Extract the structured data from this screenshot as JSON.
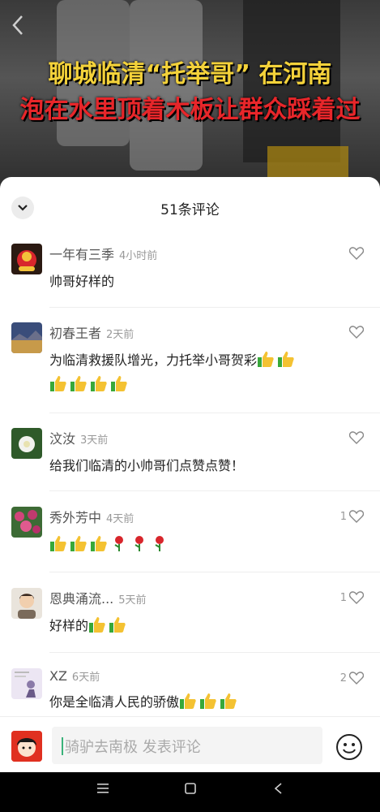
{
  "video": {
    "caption_line1": "聊城临清“托举哥” 在河南",
    "caption_line2": "泡在水里顶着木板让群众踩着过"
  },
  "sheet": {
    "title": "51条评论"
  },
  "comments": [
    {
      "name": "一年有三季",
      "time": "4小时前",
      "text": "帅哥好样的",
      "likes": "",
      "emojis": ""
    },
    {
      "name": "初春王者",
      "time": "2天前",
      "text": "为临清救援队增光，力托举小哥贺彩",
      "likes": "",
      "emojis": "thumbs-up x6"
    },
    {
      "name": "汶汝",
      "time": "3天前",
      "text": "给我们临清的小帅哥们点赞点赞！",
      "likes": "",
      "emojis": ""
    },
    {
      "name": "秀外芳中",
      "time": "4天前",
      "text": "",
      "likes": "1",
      "emojis": "thumbs-up x3, rose x3"
    },
    {
      "name": "恩典涌流...",
      "time": "5天前",
      "text": "好样的",
      "likes": "1",
      "emojis": "thumbs-up x2"
    },
    {
      "name": "XZ",
      "time": "6天前",
      "text": "你是全临清人民的骄傲",
      "likes": "2",
      "emojis": "thumbs-up x3"
    }
  ],
  "input": {
    "placeholder": "骑驴去南极 发表评论"
  },
  "icons": {
    "back": "chevron-left-icon",
    "collapse": "chevron-down-icon",
    "like": "heart-outline-icon",
    "emoji": "smiley-icon",
    "nav_menu": "menu-icon",
    "nav_home": "square-icon",
    "nav_back": "triangle-back-icon"
  },
  "colors": {
    "accent": "#3ab27a",
    "caption_yellow": "#f4d23a",
    "caption_red": "#e8262a"
  }
}
